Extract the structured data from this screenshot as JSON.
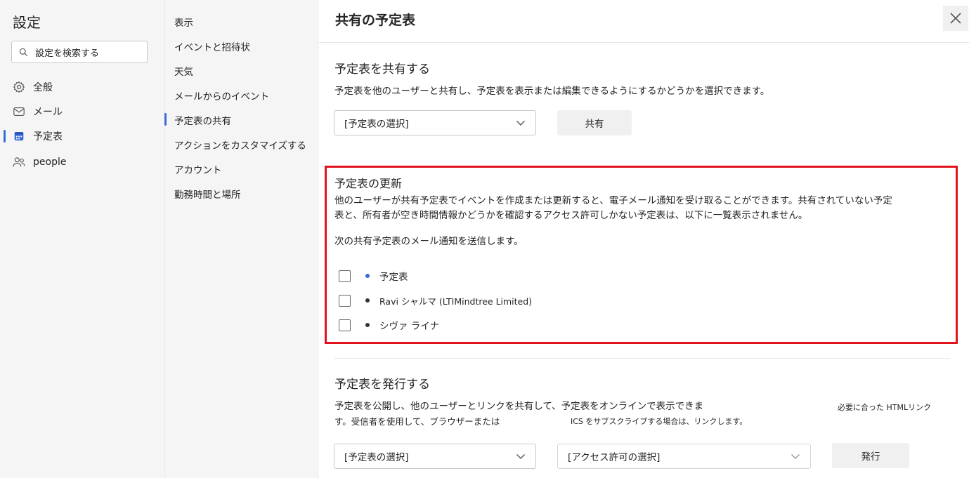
{
  "sidebar": {
    "title": "設定",
    "search_placeholder": "設定を検索する",
    "items": [
      {
        "label": "全般",
        "icon": "gear-icon"
      },
      {
        "label": "メール",
        "icon": "mail-icon"
      },
      {
        "label": "予定表",
        "icon": "calendar-icon",
        "selected": true
      },
      {
        "label": "people",
        "icon": "people-icon"
      }
    ]
  },
  "subnav": {
    "items": [
      {
        "label": "表示"
      },
      {
        "label": "イベントと招待状"
      },
      {
        "label": "天気"
      },
      {
        "label": "メールからのイベント"
      },
      {
        "label": "予定表の共有",
        "selected": true
      },
      {
        "label": "アクションをカスタマイズする"
      },
      {
        "label": "アカウント"
      },
      {
        "label": "勤務時間と場所"
      }
    ]
  },
  "main": {
    "title": "共有の予定表",
    "share": {
      "heading": "予定表を共有する",
      "description": "予定表を他のユーザーと共有し、予定表を表示または編集できるようにするかどうかを選択できます。",
      "dropdown_value": "[予定表の選択]",
      "button_label": "共有"
    },
    "updates": {
      "heading": "予定表の更新",
      "description_line1": "他のユーザーが共有予定表でイベントを作成または更新すると、電子メール通知を受け取ることができます。共有されていない予定",
      "description_line2": "表と、所有者が空き時間情報かどうかを確認するアクセス許可しかない予定表は、以下に一覧表示されません。",
      "subtext": "次の共有予定表のメール通知を送信します。",
      "calendars": [
        {
          "name": "予定表",
          "color": "#3b6bd9",
          "checked": false
        },
        {
          "name": "Ravi シャルマ (LTIMindtree Limited)",
          "color": "#333333",
          "checked": false
        },
        {
          "name": "シヴァ ライナ",
          "color": "#333333",
          "checked": false
        }
      ]
    },
    "publish": {
      "heading": "予定表を発行する",
      "description_line1": "予定表を公開し、他のユーザーとリンクを共有して、予定表をオンラインで表示できま",
      "description_line2": "す。受信者を使用して、ブラウザーまたは",
      "note_html": "必要に合った HTMLリンク",
      "note_ics": "ICS をサブスクライブする場合は、リンクします。",
      "calendar_dropdown": "[予定表の選択]",
      "permission_dropdown": "[アクセス許可の選択]",
      "button_label": "発行"
    }
  },
  "colors": {
    "accent": "#3b6bd9",
    "highlight": "#e0141e"
  }
}
